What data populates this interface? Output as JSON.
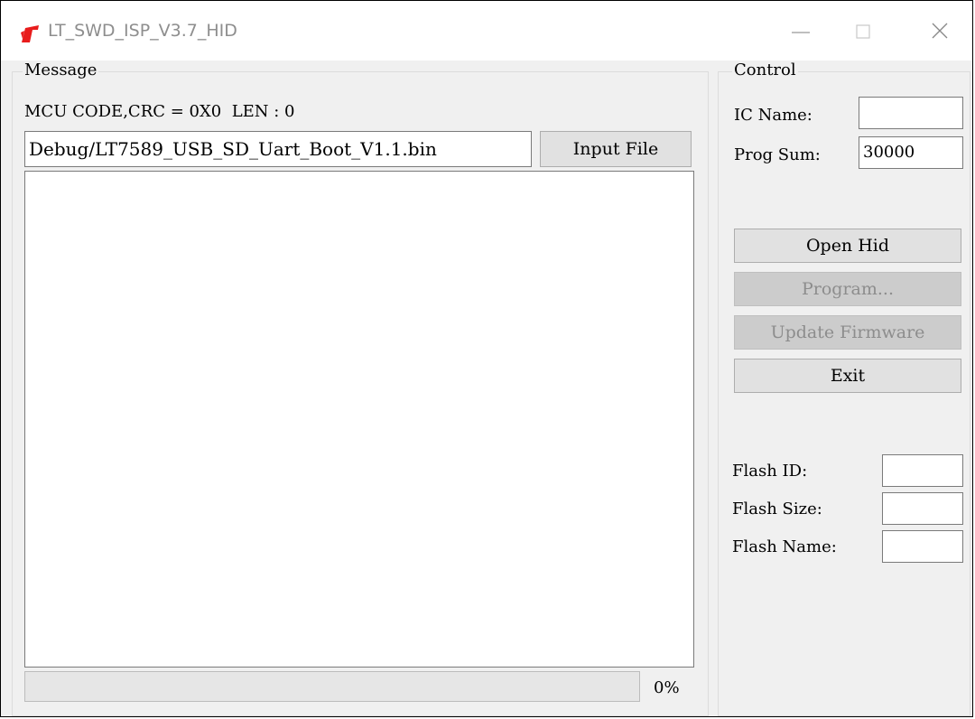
{
  "window": {
    "title": "LT_SWD_ISP_V3.7_HID",
    "icon": "red-chip-logo-icon"
  },
  "message": {
    "group_label": "Message",
    "mcu_info": "MCU CODE,CRC = 0X0  LEN : 0",
    "file_path": "Debug/LT7589_USB_SD_Uart_Boot_V1.1.bin",
    "input_file_label": "Input File",
    "log_text": "",
    "progress_text": "0%",
    "progress_value": 0
  },
  "control": {
    "group_label": "Control",
    "ic_name_label": "IC Name:",
    "ic_name_value": "",
    "prog_sum_label": "Prog Sum:",
    "prog_sum_value": "30000",
    "open_hid_label": "Open Hid",
    "program_label": "Program...",
    "update_firmware_label": "Update Firmware",
    "exit_label": "Exit",
    "flash_id_label": "Flash ID:",
    "flash_id_value": "",
    "flash_size_label": "Flash Size:",
    "flash_size_value": "",
    "flash_name_label": "Flash Name:",
    "flash_name_value": ""
  },
  "colors": {
    "accent": "#e81c1c",
    "window_bg": "#f0f0f0",
    "disabled_bg": "#cccccc"
  }
}
